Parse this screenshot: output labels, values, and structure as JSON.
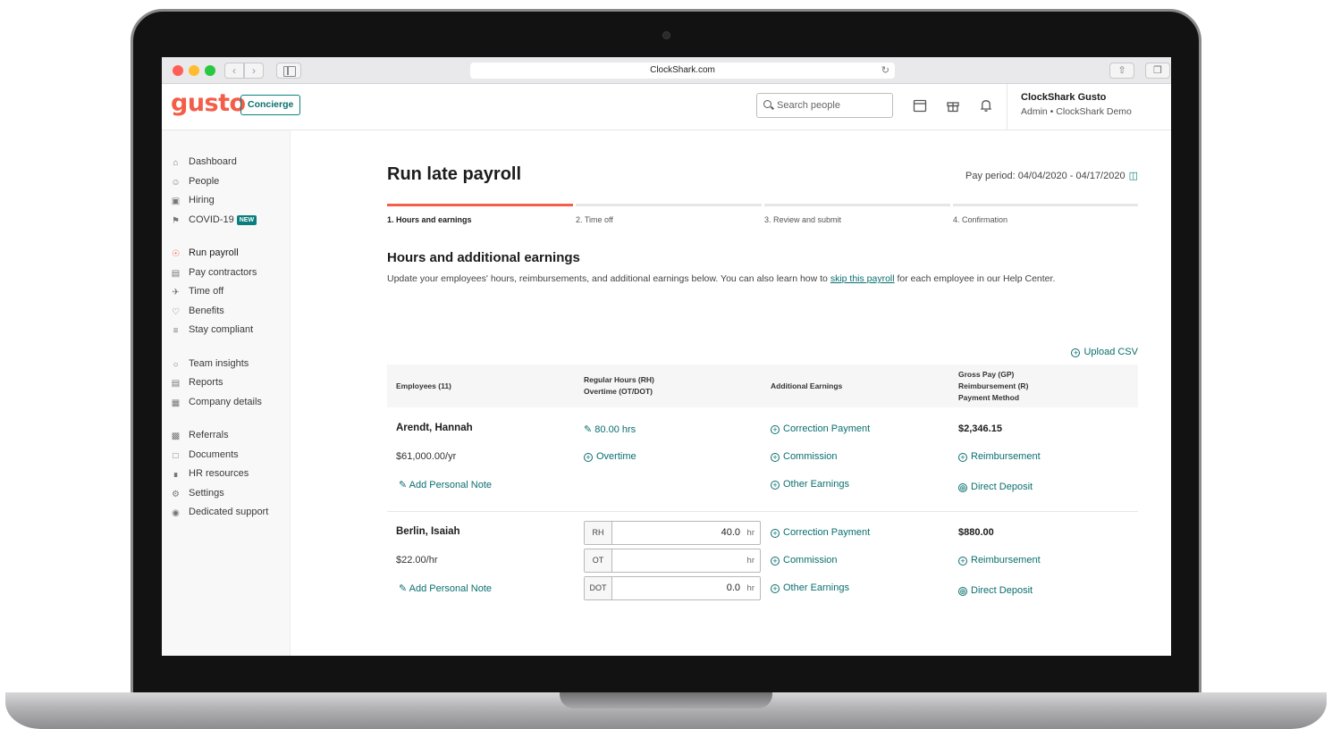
{
  "browser": {
    "url": "ClockShark.com"
  },
  "header": {
    "logo": "gusto",
    "concierge_label": "Concierge",
    "search_placeholder": "Search people",
    "account_name": "ClockShark Gusto",
    "account_role": "Admin • ClockShark Demo"
  },
  "sidebar": {
    "items": [
      {
        "label": "Dashboard",
        "icon": "home-icon"
      },
      {
        "label": "People",
        "icon": "people-icon"
      },
      {
        "label": "Hiring",
        "icon": "hiring-icon"
      },
      {
        "label": "COVID-19",
        "icon": "flag-icon",
        "badge": "NEW"
      },
      {
        "label": "Run payroll",
        "icon": "dollar-icon",
        "active": true
      },
      {
        "label": "Pay contractors",
        "icon": "cash-icon"
      },
      {
        "label": "Time off",
        "icon": "plane-icon"
      },
      {
        "label": "Benefits",
        "icon": "heart-icon"
      },
      {
        "label": "Stay compliant",
        "icon": "list-icon"
      },
      {
        "label": "Team insights",
        "icon": "chat-icon"
      },
      {
        "label": "Reports",
        "icon": "reports-icon"
      },
      {
        "label": "Company details",
        "icon": "building-icon"
      },
      {
        "label": "Referrals",
        "icon": "gift-icon"
      },
      {
        "label": "Documents",
        "icon": "document-icon"
      },
      {
        "label": "HR resources",
        "icon": "book-icon"
      },
      {
        "label": "Settings",
        "icon": "gear-icon"
      },
      {
        "label": "Dedicated support",
        "icon": "support-icon"
      }
    ]
  },
  "main": {
    "title": "Run late payroll",
    "pay_period": "Pay period: 04/04/2020 - 04/17/2020",
    "steps": [
      "1. Hours and earnings",
      "2. Time off",
      "3. Review and submit",
      "4. Confirmation"
    ],
    "section_title": "Hours and additional earnings",
    "section_desc_before": "Update your employees' hours, reimbursements, and additional earnings below.  You can also learn how to ",
    "section_desc_link": "skip this payroll",
    "section_desc_after": " for each employee in our Help Center.",
    "upload_csv": "Upload CSV",
    "table": {
      "headers": {
        "employees": "Employees (11)",
        "hours_line1": "Regular Hours (RH)",
        "hours_line2": "Overtime (OT/DOT)",
        "earnings": "Additional Earnings",
        "gross_line1": "Gross Pay (GP)",
        "gross_line2": "Reimbursement (R)",
        "gross_line3": "Payment Method"
      },
      "rows": [
        {
          "name": "Arendt, Hannah",
          "rate": "$61,000.00/yr",
          "note": "Add Personal Note",
          "hours": "80.00 hrs",
          "overtime": "Overtime",
          "earnings": [
            "Correction Payment",
            "Commission",
            "Other Earnings"
          ],
          "gross": "$2,346.15",
          "reimbursement": "Reimbursement",
          "payment_method": "Direct Deposit"
        },
        {
          "name": "Berlin, Isaiah",
          "rate": "$22.00/hr",
          "note": "Add Personal Note",
          "fields": [
            {
              "prefix": "RH",
              "value": "40.0",
              "unit": "hr"
            },
            {
              "prefix": "OT",
              "value": "",
              "unit": "hr"
            },
            {
              "prefix": "DOT",
              "value": "0.0",
              "unit": "hr"
            }
          ],
          "earnings": [
            "Correction Payment",
            "Commission",
            "Other Earnings"
          ],
          "gross": "$880.00",
          "reimbursement": "Reimbursement",
          "payment_method": "Direct Deposit"
        }
      ]
    }
  },
  "colors": {
    "brand": "#f45d48",
    "accent": "#0a6e6e"
  }
}
